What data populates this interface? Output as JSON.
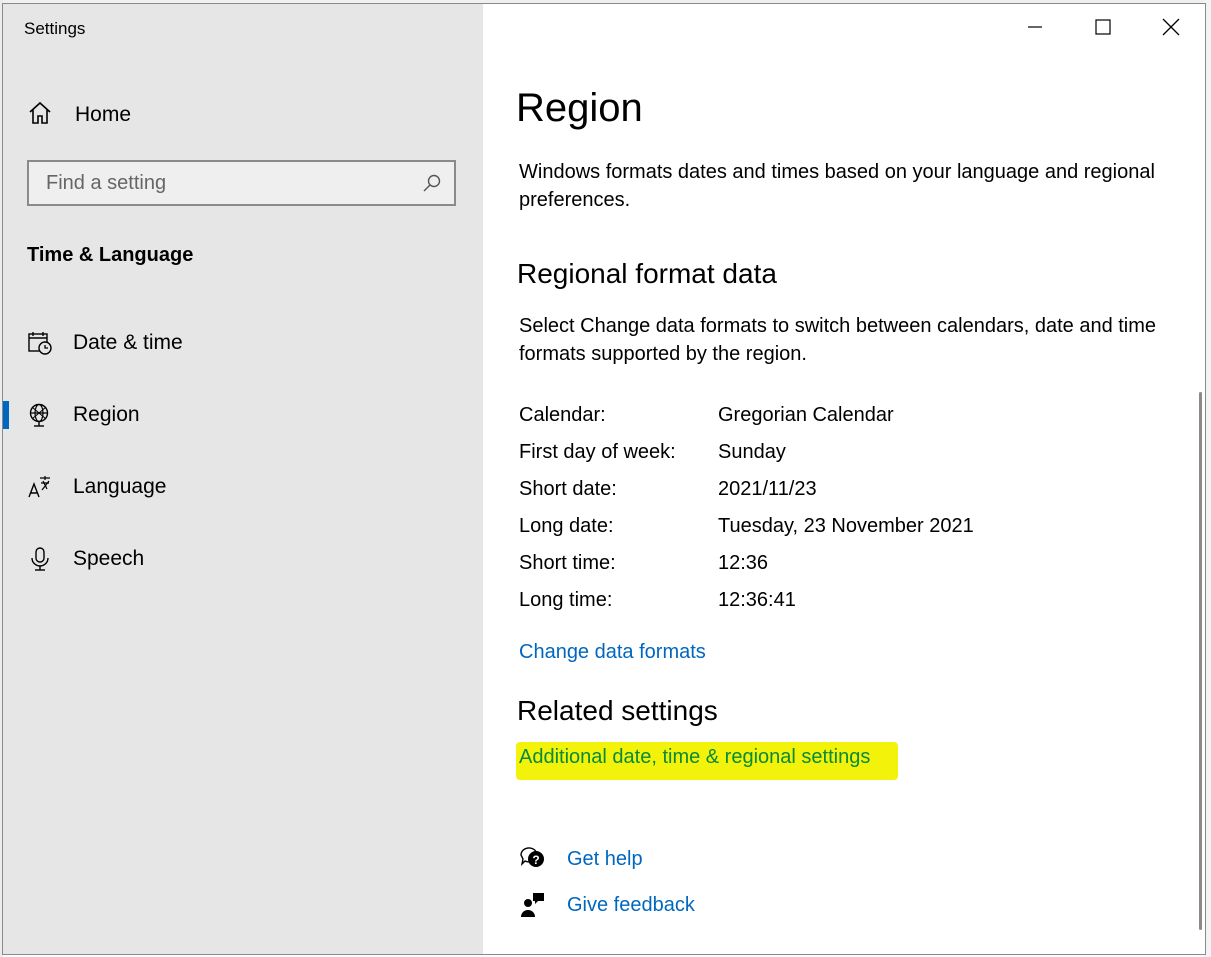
{
  "window": {
    "title": "Settings"
  },
  "sidebar": {
    "home_label": "Home",
    "search_placeholder": "Find a setting",
    "section_title": "Time & Language",
    "items": [
      {
        "label": "Date & time",
        "icon": "calendar-clock-icon"
      },
      {
        "label": "Region",
        "icon": "globe-icon",
        "active": true
      },
      {
        "label": "Language",
        "icon": "language-icon"
      },
      {
        "label": "Speech",
        "icon": "microphone-icon"
      }
    ]
  },
  "controls": {
    "minimize": "minimize-icon",
    "maximize": "maximize-icon",
    "close": "close-icon"
  },
  "main": {
    "title": "Region",
    "intro": "Windows formats dates and times based on your language and regional preferences.",
    "regional_format": {
      "heading": "Regional format data",
      "description": "Select Change data formats to switch between calendars, date and time formats supported by the region.",
      "rows": [
        {
          "key": "Calendar:",
          "value": "Gregorian Calendar"
        },
        {
          "key": "First day of week:",
          "value": "Sunday"
        },
        {
          "key": "Short date:",
          "value": "2021/11/23"
        },
        {
          "key": "Long date:",
          "value": "Tuesday, 23 November 2021"
        },
        {
          "key": "Short time:",
          "value": "12:36"
        },
        {
          "key": "Long time:",
          "value": "12:36:41"
        }
      ],
      "change_link": "Change data formats"
    },
    "related": {
      "heading": "Related settings",
      "link": "Additional date, time & regional settings"
    },
    "help": {
      "get_help": "Get help",
      "give_feedback": "Give feedback"
    }
  },
  "colors": {
    "accent": "#0067c0",
    "sidebar_bg": "#e6e6e6",
    "highlight": "#f2f20a"
  }
}
